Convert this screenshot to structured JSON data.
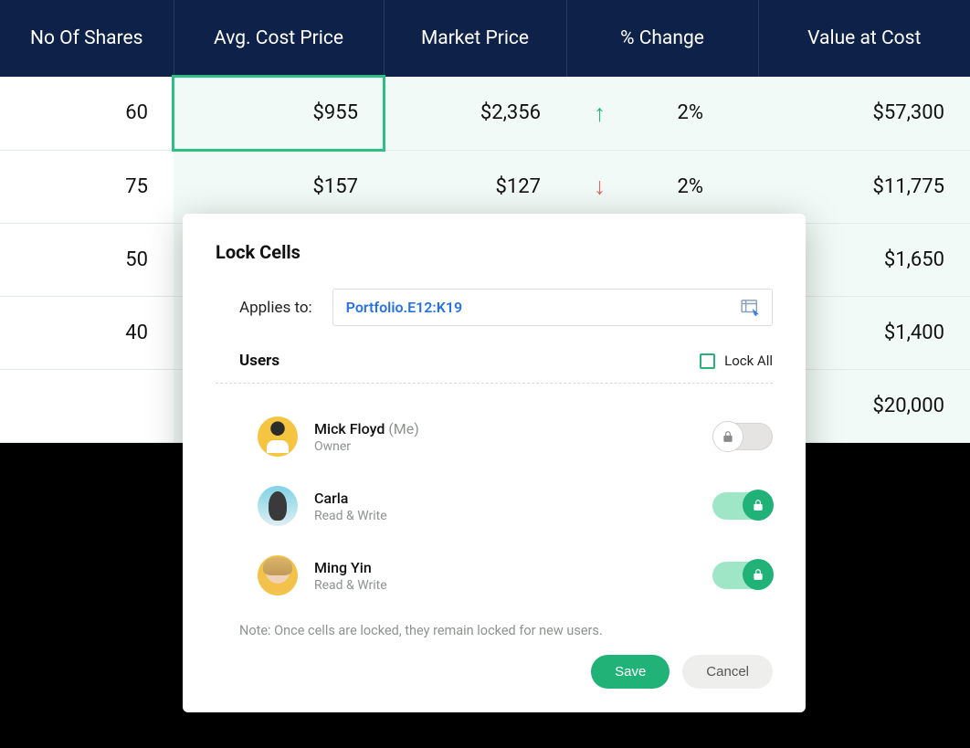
{
  "table": {
    "headers": [
      "No Of Shares",
      "Avg. Cost Price",
      "Market Price",
      "% Change",
      "Value at Cost"
    ],
    "rows": [
      {
        "shares": "60",
        "avg": "$955",
        "market": "$2,356",
        "direction": "up",
        "change": "2%",
        "value": "$57,300"
      },
      {
        "shares": "75",
        "avg": "$157",
        "market": "$127",
        "direction": "down",
        "change": "2%",
        "value": "$11,775"
      },
      {
        "shares": "50",
        "avg": "",
        "market": "",
        "direction": "",
        "change": "",
        "value": "$1,650"
      },
      {
        "shares": "40",
        "avg": "",
        "market": "",
        "direction": "",
        "change": "",
        "value": "$1,400"
      },
      {
        "shares": "",
        "avg": "",
        "market": "",
        "direction": "",
        "change": "",
        "value": "$20,000"
      }
    ]
  },
  "dialog": {
    "title": "Lock Cells",
    "applies_label": "Applies to:",
    "applies_value": "Portfolio.E12:K19",
    "users_label": "Users",
    "lockall_label": "Lock All",
    "users": [
      {
        "name": "Mick Floyd",
        "suffix": "(Me)",
        "role": "Owner",
        "locked": false
      },
      {
        "name": "Carla",
        "suffix": "",
        "role": "Read & Write",
        "locked": true
      },
      {
        "name": "Ming Yin",
        "suffix": "",
        "role": "Read & Write",
        "locked": true
      }
    ],
    "note": "Note: Once cells are locked, they remain locked for new users.",
    "save_label": "Save",
    "cancel_label": "Cancel"
  }
}
